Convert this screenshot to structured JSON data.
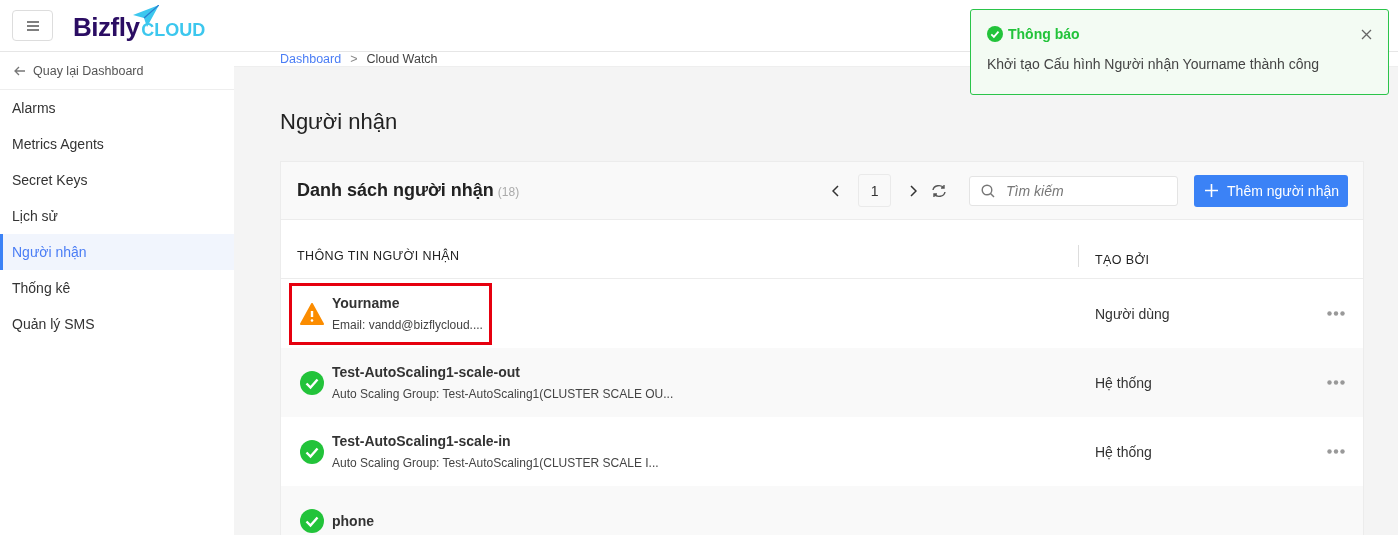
{
  "header": {
    "logo_main": "Bizfly",
    "logo_sub": "CLOUD"
  },
  "sidebar": {
    "back": "Quay lại Dashboard",
    "items": [
      {
        "label": "Alarms",
        "selected": false
      },
      {
        "label": "Metrics Agents",
        "selected": false
      },
      {
        "label": "Secret Keys",
        "selected": false
      },
      {
        "label": "Lịch sử",
        "selected": false
      },
      {
        "label": "Người nhận",
        "selected": true
      },
      {
        "label": "Thống kê",
        "selected": false
      },
      {
        "label": "Quản lý SMS",
        "selected": false
      }
    ]
  },
  "breadcrumb": [
    "Dashboard",
    ">",
    "Cloud Watch"
  ],
  "page_title": "Người nhận",
  "card": {
    "title": "Danh sách người nhận",
    "count": "(18)",
    "page": "1",
    "search": {
      "placeholder": "Tìm kiếm"
    },
    "add_button": "Thêm người nhận",
    "columns": [
      "THÔNG TIN NGƯỜI NHẬN",
      "TẠO BỞI"
    ],
    "rows": [
      {
        "kind": "warning",
        "name": "Yourname",
        "detail": "Email: vandd@bizflycloud....",
        "created_by": "Người dùng",
        "highlighted": true
      },
      {
        "kind": "ok",
        "name": "Test-AutoScaling1-scale-out",
        "detail": "Auto Scaling Group: Test-AutoScaling1(CLUSTER SCALE OU...",
        "created_by": "Hệ thống",
        "highlighted": false
      },
      {
        "kind": "ok",
        "name": "Test-AutoScaling1-scale-in",
        "detail": "Auto Scaling Group: Test-AutoScaling1(CLUSTER SCALE I...",
        "created_by": "Hệ thống",
        "highlighted": false
      },
      {
        "kind": "ok",
        "name": "phone",
        "detail": "",
        "created_by": "",
        "highlighted": false
      }
    ]
  },
  "toast": {
    "title": "Thông báo",
    "message": "Khởi tạo Cấu hình Người nhận Yourname thành công"
  }
}
